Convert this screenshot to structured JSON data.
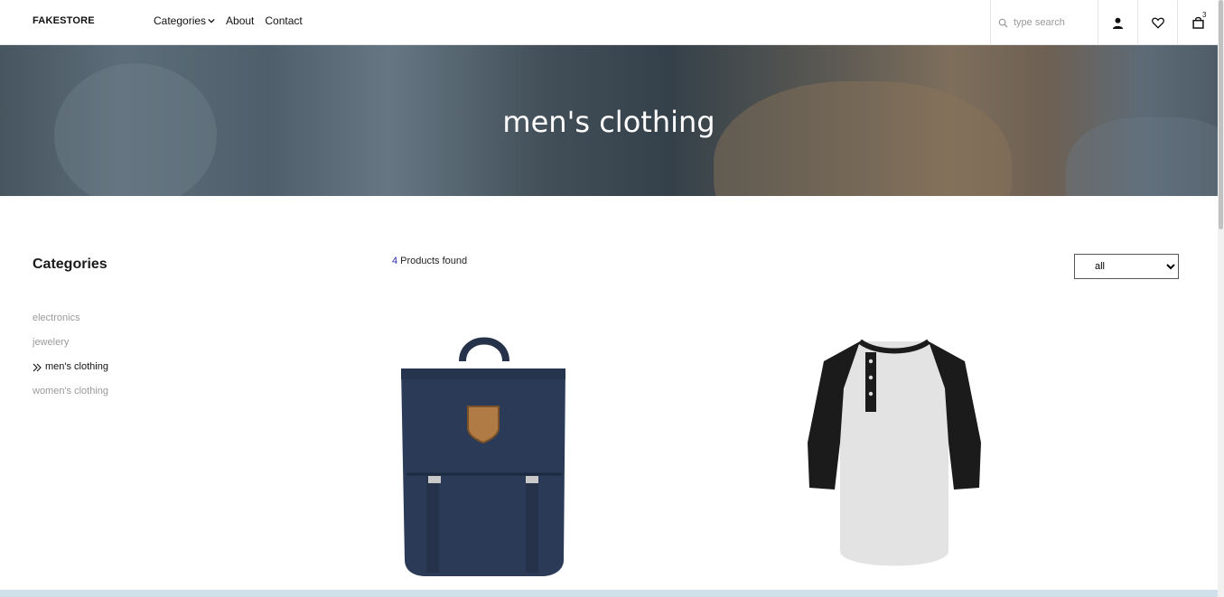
{
  "header": {
    "logo": "FAKESTORE",
    "nav": [
      "Categories",
      "About",
      "Contact"
    ],
    "search_placeholder": "type search",
    "cart_count": "3"
  },
  "hero": {
    "title": "men's clothing"
  },
  "sidebar": {
    "title": "Categories",
    "items": [
      {
        "label": "electronics",
        "active": false
      },
      {
        "label": "jewelery",
        "active": false
      },
      {
        "label": "men's clothing",
        "active": true
      },
      {
        "label": "women's clothing",
        "active": false
      }
    ]
  },
  "main": {
    "found_count": "4",
    "found_label": "Products found",
    "sort_selected": "all",
    "products": [
      {
        "name": "backpack",
        "color": "#2b3b57"
      },
      {
        "name": "henley t-shirt",
        "color": "#e1e1e1"
      }
    ]
  },
  "colors": {
    "accent": "#2b2bb0",
    "muted": "#9a9a9a"
  }
}
